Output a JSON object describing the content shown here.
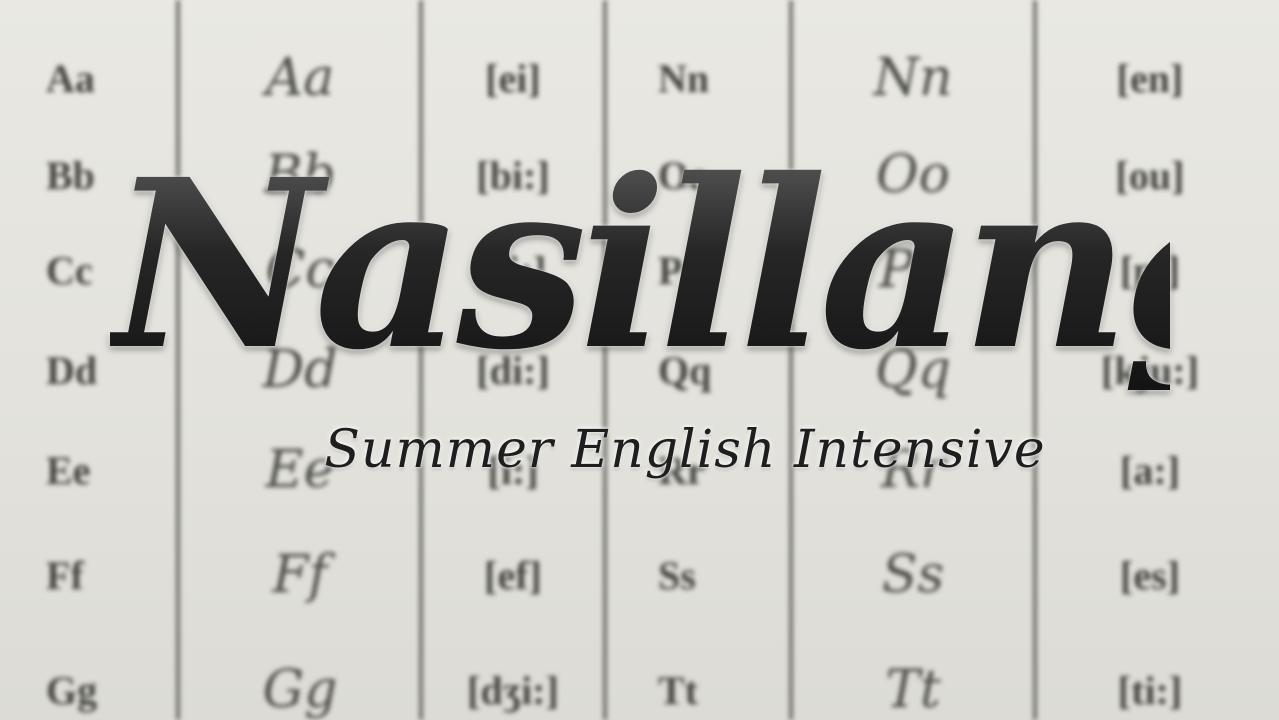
{
  "title": "Nasillang",
  "subtitle": "Summer English Intensive",
  "alphabet_table": {
    "left": [
      {
        "print": "Aa",
        "script": "Aa",
        "ipa": "[ei]"
      },
      {
        "print": "Bb",
        "script": "Bb",
        "ipa": "[bi:]"
      },
      {
        "print": "Cc",
        "script": "Cc",
        "ipa": "[si:]"
      },
      {
        "print": "Dd",
        "script": "Dd",
        "ipa": "[di:]"
      },
      {
        "print": "Ee",
        "script": "Ee",
        "ipa": "[i:]"
      },
      {
        "print": "Ff",
        "script": "Ff",
        "ipa": "[ef]"
      },
      {
        "print": "Gg",
        "script": "Gg",
        "ipa": "[dʒi:]"
      }
    ],
    "right": [
      {
        "print": "Nn",
        "script": "Nn",
        "ipa": "[en]"
      },
      {
        "print": "Oo",
        "script": "Oo",
        "ipa": "[ou]"
      },
      {
        "print": "Pp",
        "script": "Pp",
        "ipa": "[pi]"
      },
      {
        "print": "Qq",
        "script": "Qq",
        "ipa": "[kju:]"
      },
      {
        "print": "Rr",
        "script": "Rr",
        "ipa": "[a:]"
      },
      {
        "print": "Ss",
        "script": "Ss",
        "ipa": "[es]"
      },
      {
        "print": "Tt",
        "script": "Tt",
        "ipa": "[ti:]"
      }
    ]
  },
  "colors": {
    "paper": "#e6e5df",
    "ink": "#45453f",
    "title": "#1e1e1e"
  }
}
